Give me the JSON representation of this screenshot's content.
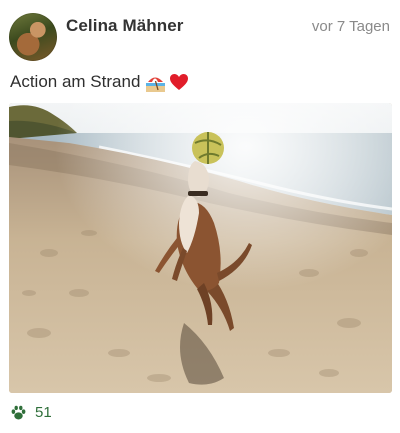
{
  "post": {
    "author": "Celina Mähner",
    "timestamp": "vor 7 Tagen",
    "caption": "Action am Strand",
    "caption_emojis": [
      "beach-umbrella-emoji",
      "red-heart-emoji"
    ],
    "likes_count": "51",
    "accent_color": "#2f6f3a"
  }
}
